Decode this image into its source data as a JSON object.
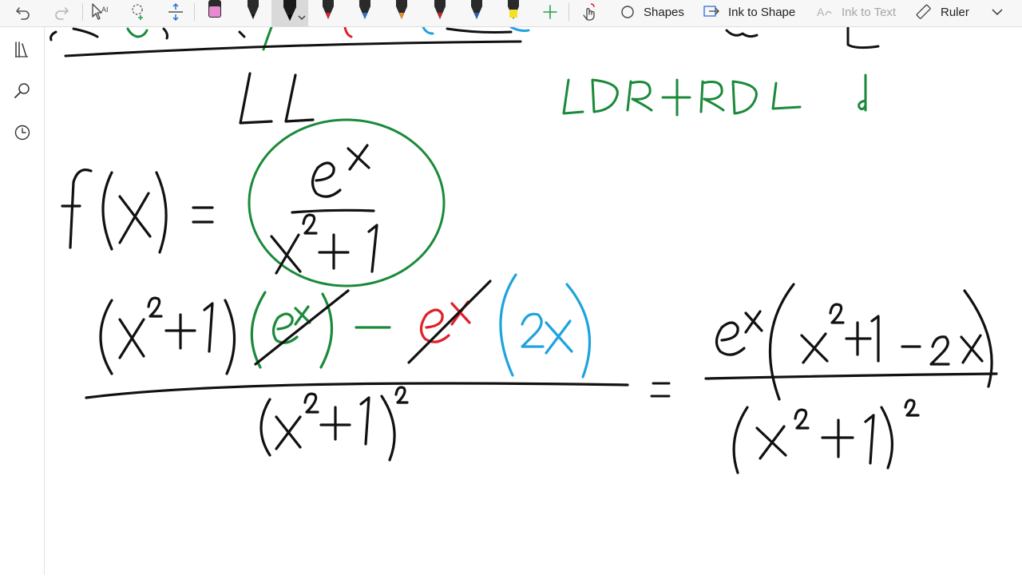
{
  "toolbar": {
    "shapes_label": "Shapes",
    "ink_to_shape_label": "Ink to Shape",
    "ink_to_text_label": "Ink to Text",
    "ruler_label": "Ruler"
  },
  "icons": {
    "undo": "undo-icon",
    "redo": "redo-icon",
    "lasso": "lasso-select-icon",
    "add_space": "add-space-icon",
    "eraser": "eraser-icon",
    "add_pen": "plus-icon",
    "touch": "draw-with-touch-icon",
    "library": "library-icon",
    "search": "search-icon",
    "history": "history-icon"
  },
  "pens": [
    {
      "name": "highlighter-pink",
      "color": "#e58ad0"
    },
    {
      "name": "pen-black",
      "color": "#111111"
    },
    {
      "name": "pen-black-selected",
      "color": "#111111"
    },
    {
      "name": "pen-red",
      "color": "#e0202a"
    },
    {
      "name": "pen-blue",
      "color": "#2a72d6"
    },
    {
      "name": "pen-orange",
      "color": "#f08a24"
    },
    {
      "name": "pen-red-2",
      "color": "#d02020"
    },
    {
      "name": "pen-blue-2",
      "color": "#1e5fd0"
    },
    {
      "name": "pen-green",
      "color": "#1a8a3a"
    },
    {
      "name": "highlighter-yellow",
      "color": "#f5e021"
    }
  ],
  "ink_colors": {
    "black": "#111111",
    "green": "#1a8a3a",
    "red": "#e0202a",
    "blue": "#1fa3dd"
  }
}
